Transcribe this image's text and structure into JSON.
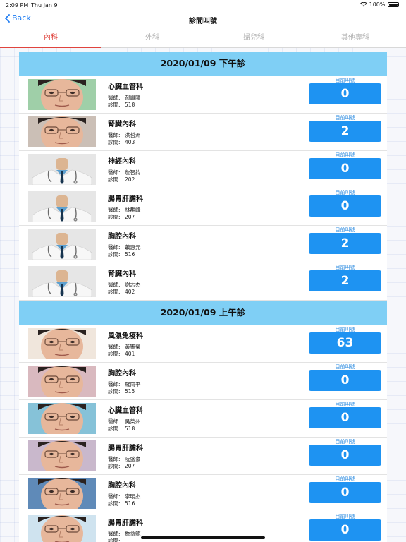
{
  "status_bar": {
    "time": "2:09 PM",
    "date": "Thu Jan 9",
    "battery": "100%"
  },
  "nav": {
    "back_label": "Back",
    "title": "診間叫號"
  },
  "tabs": [
    {
      "label": "內科",
      "active": true
    },
    {
      "label": "外科",
      "active": false
    },
    {
      "label": "婦兒科",
      "active": false
    },
    {
      "label": "其他專科",
      "active": false
    }
  ],
  "labels": {
    "current_number": "目前叫號",
    "doctor": "醫師:",
    "room": "診間:"
  },
  "colors": {
    "accent": "#1e93f2",
    "section_header": "#7fcff5",
    "active_tab": "#e0443e"
  },
  "sections": [
    {
      "title": "2020/01/09 下午診",
      "rows": [
        {
          "dept": "心臟血管科",
          "doctor": "郝繼隆",
          "room": "518",
          "number": "0",
          "photo": "man-photo"
        },
        {
          "dept": "腎臟內科",
          "doctor": "洪哲洲",
          "room": "403",
          "number": "2",
          "photo": "man-photo"
        },
        {
          "dept": "神經內科",
          "doctor": "詹智鈞",
          "room": "202",
          "number": "0",
          "photo": "doctor-placeholder"
        },
        {
          "dept": "腸胃肝膽科",
          "doctor": "林群峰",
          "room": "207",
          "number": "0",
          "photo": "doctor-placeholder"
        },
        {
          "dept": "胸腔內科",
          "doctor": "蕭惠元",
          "room": "516",
          "number": "2",
          "photo": "doctor-placeholder"
        },
        {
          "dept": "腎臟內科",
          "doctor": "謝志杰",
          "room": "402",
          "number": "2",
          "photo": "doctor-placeholder"
        }
      ]
    },
    {
      "title": "2020/01/09 上午診",
      "rows": [
        {
          "dept": "風濕免疫科",
          "doctor": "黃聖榮",
          "room": "401",
          "number": "63",
          "photo": "man-photo"
        },
        {
          "dept": "胸腔內科",
          "doctor": "羅雨平",
          "room": "515",
          "number": "0",
          "photo": "man-photo"
        },
        {
          "dept": "心臟血管科",
          "doctor": "吳榮州",
          "room": "518",
          "number": "0",
          "photo": "man-photo"
        },
        {
          "dept": "腸胃肝膽科",
          "doctor": "阮盛豪",
          "room": "207",
          "number": "0",
          "photo": "man-photo"
        },
        {
          "dept": "胸腔內科",
          "doctor": "李明杰",
          "room": "516",
          "number": "0",
          "photo": "man-photo"
        },
        {
          "dept": "腸胃肝膽科",
          "doctor": "詹益甑",
          "room": "",
          "number": "0",
          "photo": "man-photo"
        }
      ]
    }
  ]
}
